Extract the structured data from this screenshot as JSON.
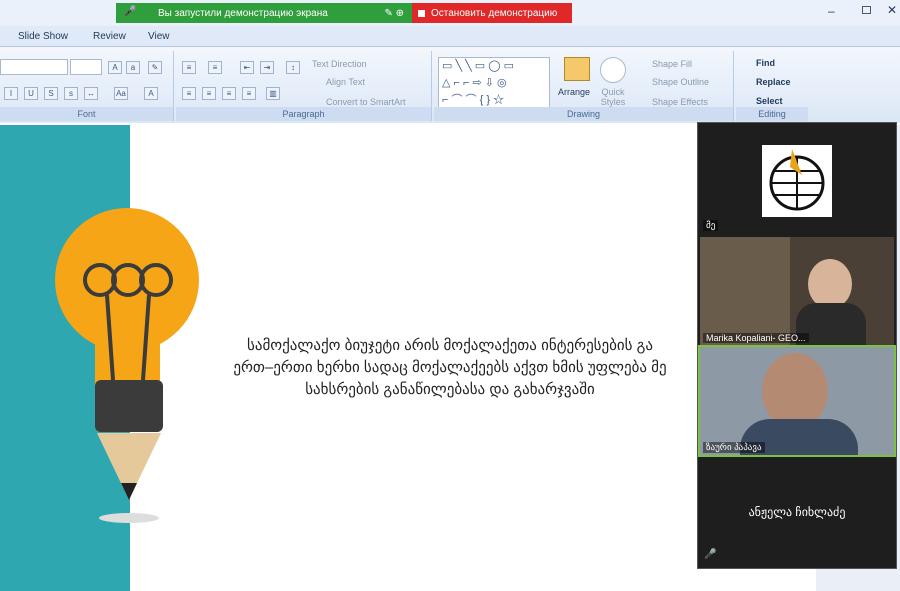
{
  "share_banner": {
    "text": "Вы запустили демонстрацию экрана",
    "stop_label": "Остановить демонстрацию"
  },
  "tabs": [
    "Slide Show",
    "Review",
    "View"
  ],
  "ribbon": {
    "groups": {
      "font": "Font",
      "paragraph": "Paragraph",
      "drawing": "Drawing",
      "editing": "Editing"
    },
    "paragraph_items": [
      "Text Direction",
      "Align Text",
      "Convert to SmartArt"
    ],
    "drawing_items": [
      "Arrange",
      "Quick Styles",
      "Shape Fill",
      "Shape Outline",
      "Shape Effects"
    ],
    "editing_items": [
      "Find",
      "Replace",
      "Select"
    ]
  },
  "slide": {
    "lines": [
      "სამოქალაქო ბიუჯეტი არის მოქალაქეთა ინტერესების გა",
      "ერთ–ერთი ხერხი სადაც მოქალაქეებს აქვთ ხმის უფლება მე",
      "სახსრების განაწილებასა და გახარჯვაში"
    ]
  },
  "participants": [
    {
      "name": "მე"
    },
    {
      "name": "Marika Kopaliani- GEO..."
    },
    {
      "name": "ზაური პაპავა"
    },
    {
      "name": "ანჟელა ჩიხლაძე"
    }
  ],
  "colors": {
    "teal": "#2ea7b0",
    "bulb": "#f5a516",
    "green": "#2f9e3c",
    "red": "#e02828"
  }
}
